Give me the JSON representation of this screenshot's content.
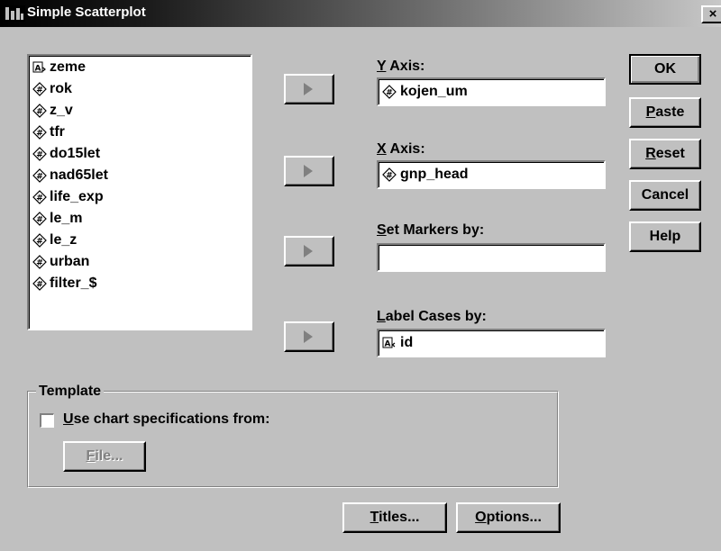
{
  "window": {
    "title": "Simple Scatterplot",
    "close_label": "×"
  },
  "variables": [
    {
      "name": "zeme",
      "type": "string"
    },
    {
      "name": "rok",
      "type": "numeric"
    },
    {
      "name": "z_v",
      "type": "numeric"
    },
    {
      "name": "tfr",
      "type": "numeric"
    },
    {
      "name": "do15let",
      "type": "numeric"
    },
    {
      "name": "nad65let",
      "type": "numeric"
    },
    {
      "name": "life_exp",
      "type": "numeric"
    },
    {
      "name": "le_m",
      "type": "numeric"
    },
    {
      "name": "le_z",
      "type": "numeric"
    },
    {
      "name": "urban",
      "type": "numeric"
    },
    {
      "name": "filter_$",
      "type": "numeric"
    }
  ],
  "fields": {
    "y_axis": {
      "label_mnemonic": "Y",
      "label_rest": " Axis:",
      "value": "kojen_um",
      "icon": "numeric-variable-icon"
    },
    "x_axis": {
      "label_mnemonic": "X",
      "label_rest": " Axis:",
      "value": "gnp_head",
      "icon": "numeric-variable-icon"
    },
    "set_markers": {
      "label_mnemonic": "S",
      "label_rest": "et Markers by:",
      "value": ""
    },
    "label_cases": {
      "label_mnemonic": "L",
      "label_rest": "abel Cases by:",
      "value": "id",
      "icon": "string-variable-icon"
    }
  },
  "buttons": {
    "ok": "OK",
    "paste_mnemonic": "P",
    "paste_rest": "aste",
    "reset_mnemonic": "R",
    "reset_rest": "eset",
    "cancel": "Cancel",
    "help": "Help",
    "titles_mnemonic": "T",
    "titles_rest": "itles...",
    "options_mnemonic": "O",
    "options_rest": "ptions..."
  },
  "template": {
    "title": "Template",
    "checkbox_mnemonic": "U",
    "checkbox_rest": "se chart specifications from:",
    "checked": false,
    "file_mnemonic": "F",
    "file_rest": "ile..."
  },
  "colors": {
    "face": "#c0c0c0",
    "title_start": "#000000",
    "title_end": "#c8c8c8",
    "disabled_text": "#808080"
  }
}
